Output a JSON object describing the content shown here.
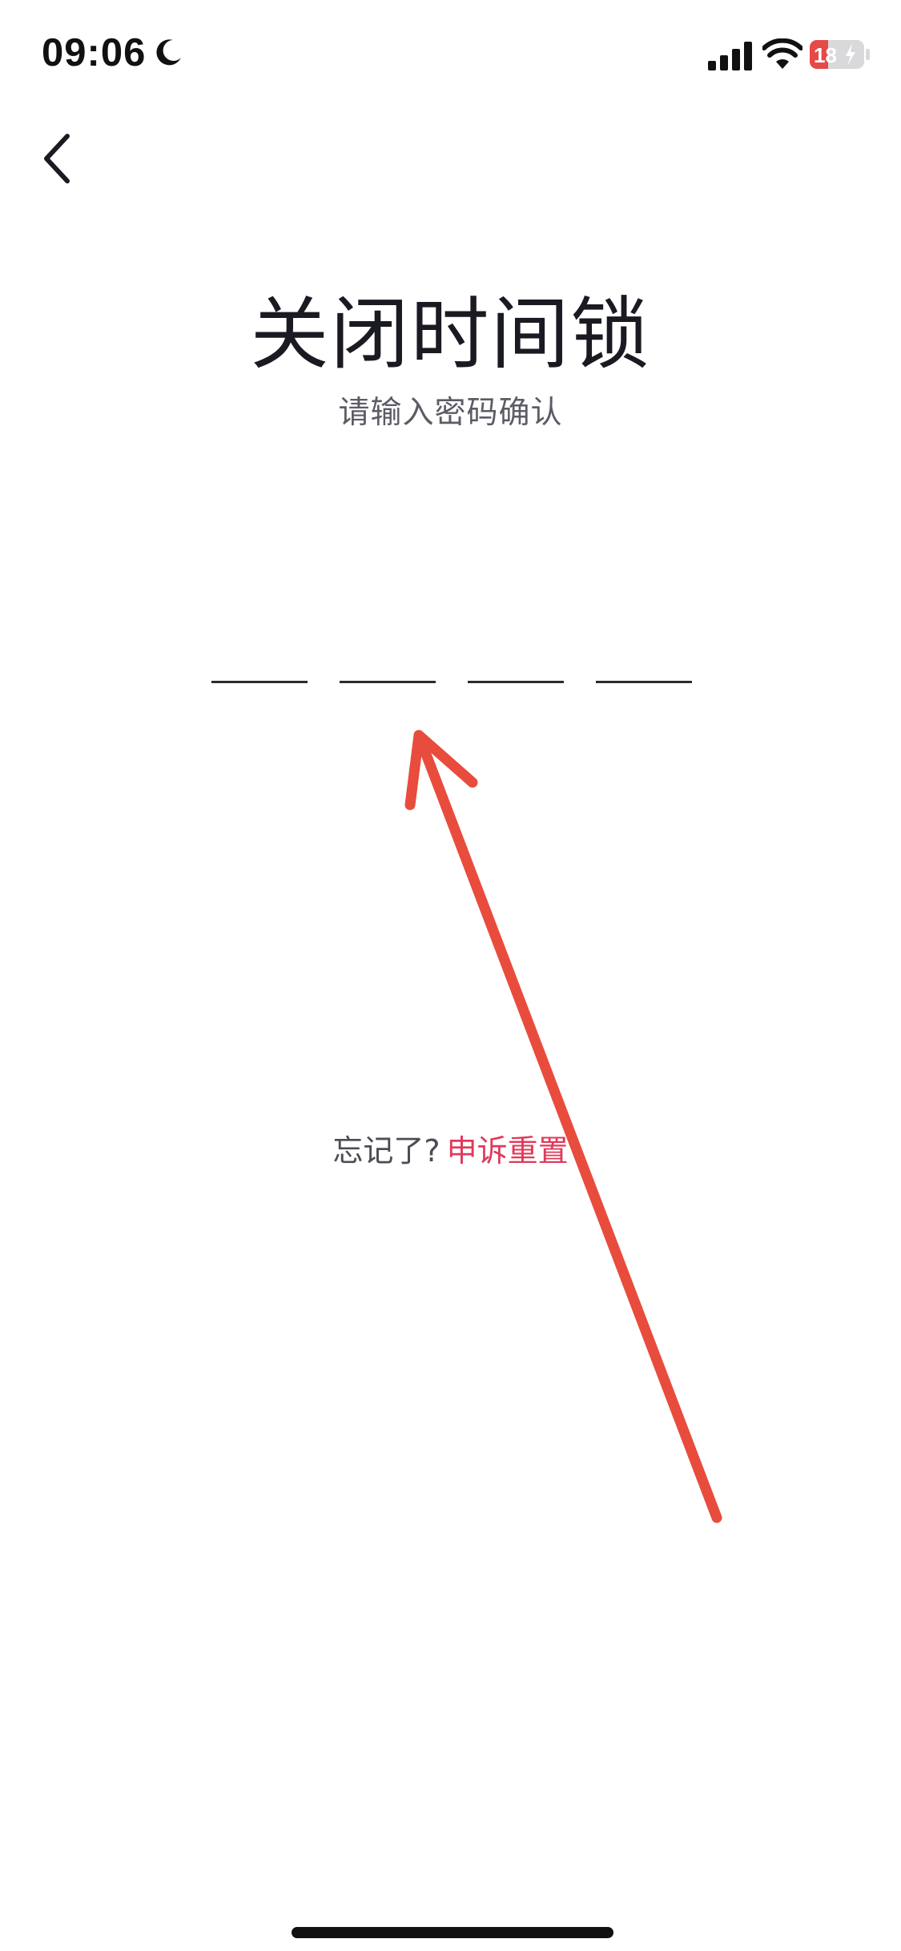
{
  "status_bar": {
    "time": "09:06",
    "battery_level": "18",
    "icons": [
      "moon-icon",
      "signal-icon",
      "wifi-icon",
      "battery-charging-icon"
    ]
  },
  "nav": {
    "back_icon": "chevron-left-icon"
  },
  "header": {
    "title": "关闭时间锁",
    "subtitle": "请输入密码确认"
  },
  "pin": {
    "length": 4,
    "entered": ""
  },
  "footer": {
    "forgot_label": "忘记了?",
    "reset_link": "申诉重置"
  },
  "colors": {
    "accent_link": "#e0395a",
    "annotation_arrow": "#e84c3d",
    "battery_low": "#e64a47"
  }
}
